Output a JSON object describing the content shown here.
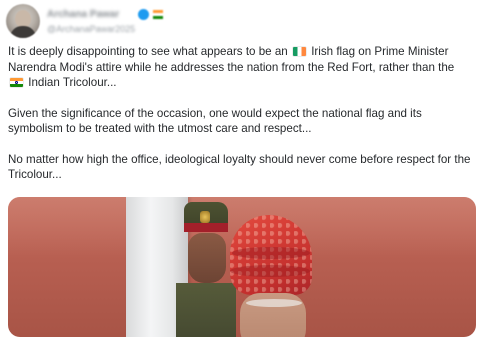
{
  "post": {
    "author": {
      "display_name": "Archana Pawar",
      "handle": "@ArchanaPawar2025",
      "avatar_icon": "profile-photo",
      "verified_icon": "verified-badge-icon",
      "name_badge_icon": "indian-flag-badge-icon"
    },
    "paragraphs": [
      {
        "before": "It is deeply disappointing to see what appears to be an",
        "flag": "irish-flag-emoji",
        "after": "Irish flag on Prime Minister Narendra Modi's attire while he addresses the nation from the Red Fort, rather than the",
        "flag2": "indian-flag-emoji",
        "end": "Indian Tricolour..."
      },
      {
        "text": "Given the significance of the occasion, one would expect the national flag and its symbolism to be treated with the utmost care and respect..."
      },
      {
        "text": "No matter how high the office, ideological loyalty should never come before respect for the Tricolour..."
      }
    ],
    "media": {
      "type": "photo",
      "colors": {
        "wall": "#b75f51",
        "turban": "#d23a34",
        "uniform": "#4d5232",
        "flagpole": "#f4f5f6"
      }
    }
  }
}
